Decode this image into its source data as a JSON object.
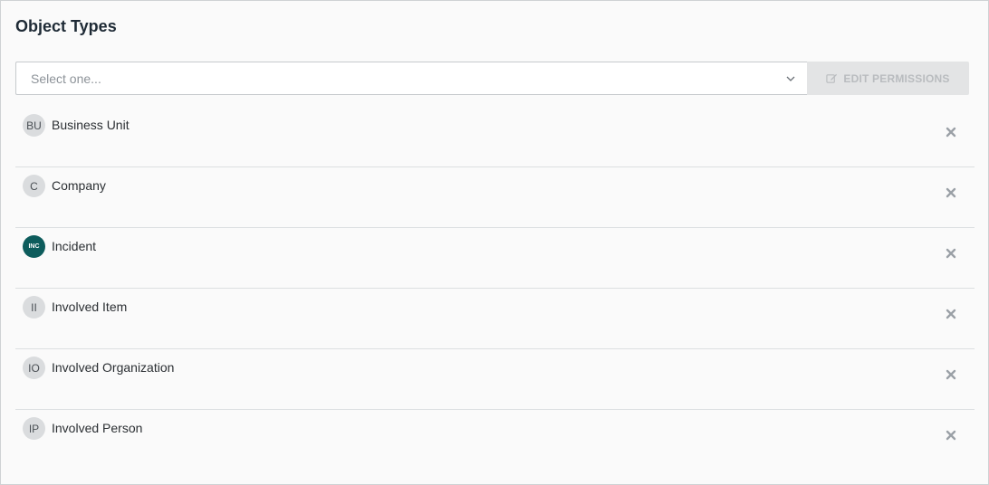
{
  "header": {
    "title": "Object Types"
  },
  "toolbar": {
    "select_placeholder": "Select one...",
    "edit_label": "EDIT PERMISSIONS"
  },
  "items": [
    {
      "initials": "BU",
      "label": "Business Unit",
      "style": "light"
    },
    {
      "initials": "C",
      "label": "Company",
      "style": "light"
    },
    {
      "initials": "INC",
      "label": "Incident",
      "style": "dark"
    },
    {
      "initials": "II",
      "label": "Involved Item",
      "style": "light"
    },
    {
      "initials": "IO",
      "label": "Involved Organization",
      "style": "light"
    },
    {
      "initials": "IP",
      "label": "Involved Person",
      "style": "light"
    }
  ],
  "icons": {
    "select_arrow": "chevron-down-icon",
    "edit": "edit-pen-icon",
    "remove": "close-icon"
  },
  "colors": {
    "incident_avatar": "#0d5c5c",
    "button_disabled_bg": "#e3e4e5"
  }
}
